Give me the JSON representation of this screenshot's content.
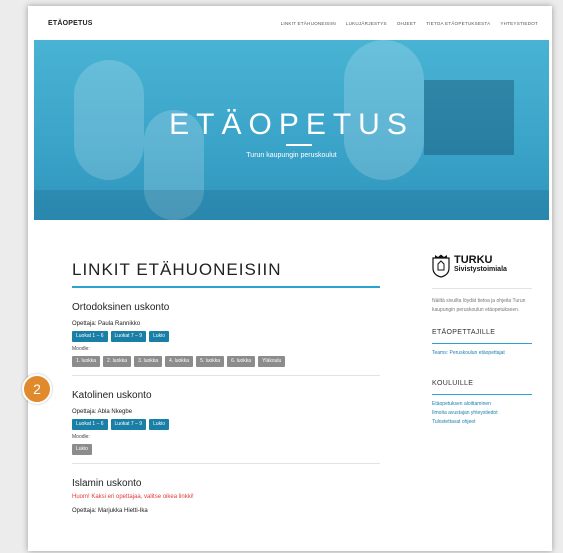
{
  "nav": {
    "brand": "ETÄOPETUS",
    "links": [
      "LINKIT ETÄHUONEISIIN",
      "LUKUJÄRJESTYS",
      "OHJEET",
      "TIETOA ETÄOPETUKSESTA",
      "YHTEYSTIEDOT"
    ]
  },
  "hero": {
    "title": "ETÄOPETUS",
    "subtitle": "Turun kaupungin peruskoulut"
  },
  "main": {
    "title": "LINKIT ETÄHUONEISIIN",
    "sections": [
      {
        "heading": "Ortodoksinen uskonto",
        "teacher": "Opettaja: Paula Rannikko",
        "room_buttons": [
          "Luokat 1 – 6",
          "Luokat 7 – 9",
          "Lukio"
        ],
        "moodle_label": "Moodle:",
        "moodle_buttons": [
          "1. luokka",
          "2. luokka",
          "3. luokka",
          "4. luokka",
          "5. luokka",
          "6. luokka",
          "Yläkoulu"
        ]
      },
      {
        "heading": "Katolinen uskonto",
        "teacher": "Opettaja: Abla Nkegbe",
        "room_buttons": [
          "Luokat 1 – 6",
          "Luokat 7 – 9",
          "Lukio"
        ],
        "moodle_label": "Moodle:",
        "moodle_buttons": [
          "Lukio"
        ]
      },
      {
        "heading": "Islamin uskonto",
        "warning": "Huom! Kaksi eri opettajaa, valitse oikea linkki!",
        "teacher": "Opettaja: Marjukka Hietti-Ika"
      }
    ]
  },
  "sidebar": {
    "logo_title": "TURKU",
    "logo_subtitle": "Sivistystoimiala",
    "description": "Näiltä sivuilta löydät tietoa ja ohjeita Turun kaupungin peruskoulun etäopetukseen.",
    "sections": [
      {
        "heading": "ETÄOPETTAJILLE",
        "links": [
          "Teams: Peruskoulun etäopettajat"
        ]
      },
      {
        "heading": "KOULUILLE",
        "links": [
          "Etäopetuksen aloittaminen",
          "Ilmoita avustajan yhteystiedot",
          "Tulostettavat ohjeet"
        ]
      }
    ]
  },
  "badge": {
    "number": "2",
    "color": "#e08a2d"
  },
  "colors": {
    "accent": "#2aa3cf",
    "button_blue": "#1a7fa6",
    "button_grey": "#8c8c8c",
    "warning": "#e23b3b"
  }
}
